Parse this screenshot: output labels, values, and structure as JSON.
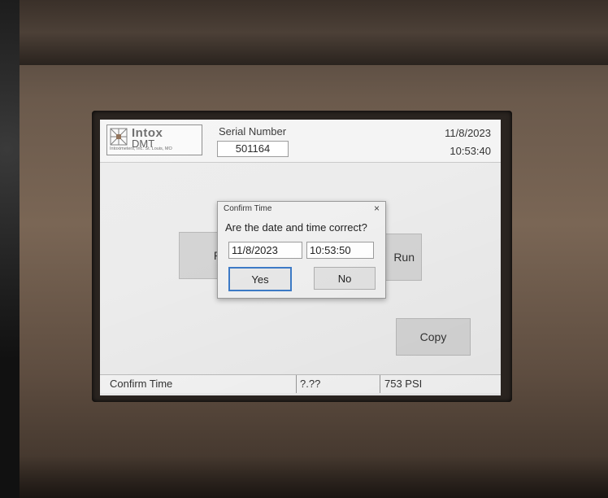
{
  "header": {
    "logo": {
      "brand": "Intox",
      "product": "DMT",
      "tagline": "Intoximeters, Inc. St. Louis, MO"
    },
    "serial_label": "Serial Number",
    "serial_value": "501164",
    "date": "11/8/2023",
    "time": "10:53:40"
  },
  "background_buttons": {
    "left_partial": "R",
    "run": "Run",
    "copy": "Copy"
  },
  "status_bar": {
    "message": "Confirm Time",
    "reading": "?.??",
    "pressure": "753 PSI"
  },
  "dialog": {
    "title": "Confirm Time",
    "close_glyph": "×",
    "question": "Are the date and time correct?",
    "date_value": "11/8/2023",
    "time_value": "10:53:50",
    "yes_label": "Yes",
    "no_label": "No"
  }
}
